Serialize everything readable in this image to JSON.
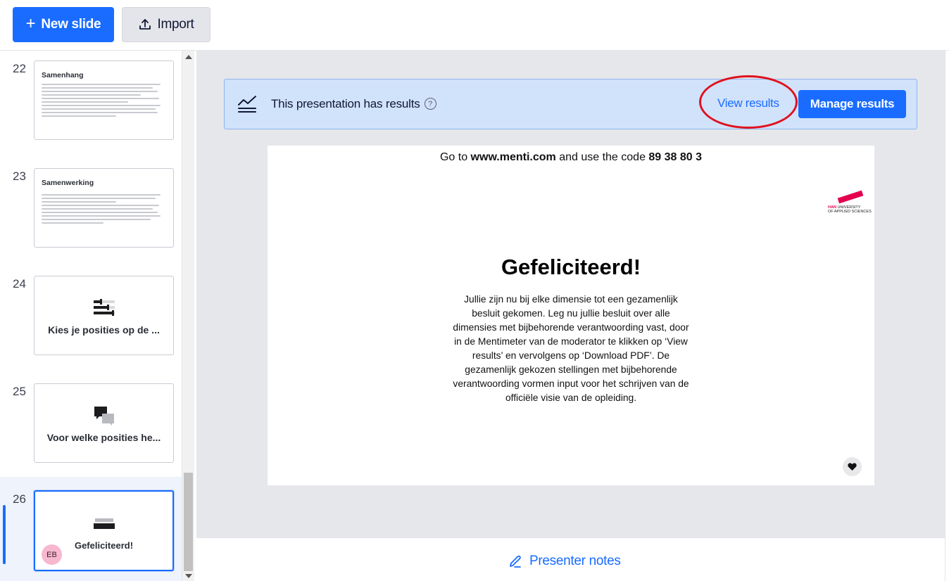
{
  "toolbar": {
    "new_slide_label": "New slide",
    "import_label": "Import"
  },
  "sidebar": {
    "slides": [
      {
        "number": "22",
        "title": "Samenhang",
        "type": "text"
      },
      {
        "number": "23",
        "title": "Samenwerking",
        "type": "text"
      },
      {
        "number": "24",
        "title": "Kies je posities op de ...",
        "type": "scales",
        "icon": "scales-icon"
      },
      {
        "number": "25",
        "title": "Voor welke posities he...",
        "type": "open-ended",
        "icon": "speech-bubbles-icon"
      },
      {
        "number": "26",
        "title": "Gefeliciteerd!",
        "type": "heading",
        "icon": "heading-icon",
        "selected": true,
        "avatar": "EB"
      }
    ]
  },
  "banner": {
    "text": "This presentation has results",
    "help_icon": "?",
    "view_results_label": "View results",
    "manage_results_label": "Manage results",
    "annotation_color": "#e0121c"
  },
  "slide": {
    "join_prefix": "Go to ",
    "join_url": "www.menti.com",
    "join_middle": " and use the code ",
    "join_code": "89 38 80 3",
    "logo_han": "HAN",
    "logo_line1": "UNIVERSITY",
    "logo_line2": "OF APPLIED SCIENCES",
    "heading": "Gefeliciteerd!",
    "body": "Jullie zijn nu bij elke dimensie tot een gezamenlijk besluit gekomen. Leg nu jullie besluit over alle dimensies met bijbehorende verantwoording vast, door in de Mentimeter van de moderator te klikken op ‘View results’ en vervolgens op ‘Download PDF’. De gezamenlijk gekozen stellingen met bijbehorende verantwoording vormen input voor het schrijven van de officiële visie van de opleiding."
  },
  "notes": {
    "label": "Presenter notes"
  },
  "colors": {
    "accent": "#196cff",
    "banner_bg": "#d1e2fb",
    "canvas_bg": "#e6e7eb",
    "brand_han": "#e5004f"
  }
}
